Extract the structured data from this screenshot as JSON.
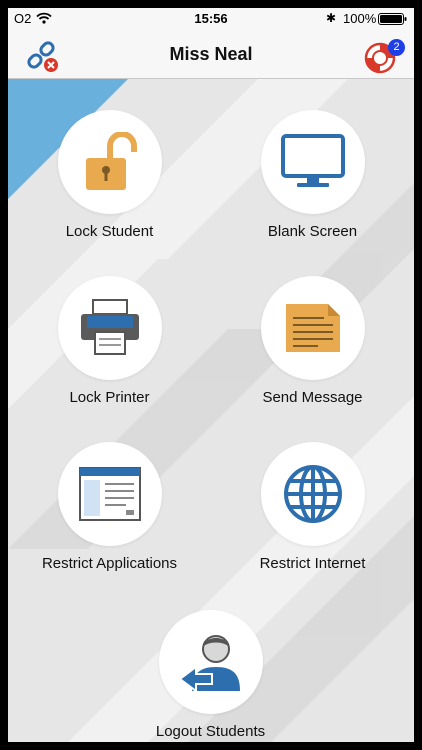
{
  "status_bar": {
    "carrier": "O2",
    "time": "15:56",
    "battery": "100%"
  },
  "nav": {
    "title": "Miss Neal",
    "help_badge_count": "2"
  },
  "actions": {
    "lock_student": "Lock Student",
    "blank_screen": "Blank Screen",
    "lock_printer": "Lock Printer",
    "send_message": "Send Message",
    "restrict_applications": "Restrict Applications",
    "restrict_internet": "Restrict Internet",
    "logout_students": "Logout Students"
  },
  "colors": {
    "accent_blue": "#2d6fae",
    "icon_orange": "#e9a94f",
    "corner_blue": "#6ab0dd",
    "badge_blue": "#1f3fe6",
    "close_red": "#d9392b"
  }
}
